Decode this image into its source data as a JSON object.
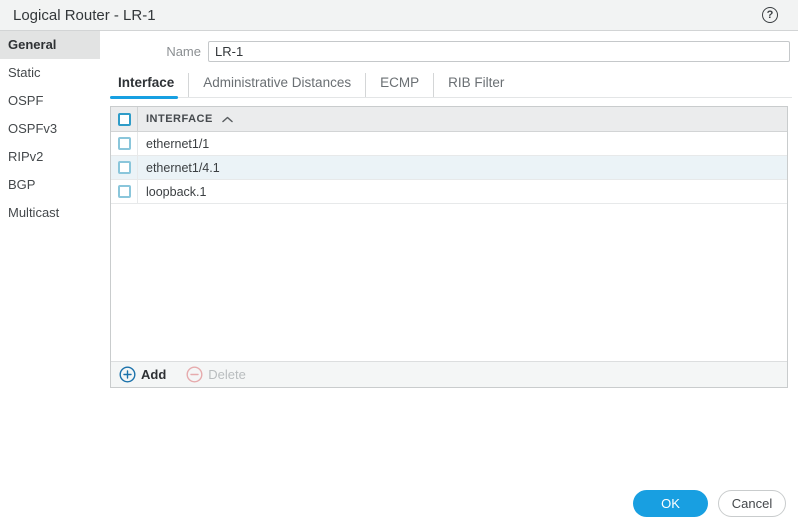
{
  "dialog": {
    "title": "Logical Router - LR-1",
    "help_glyph": "?"
  },
  "sidebar": {
    "items": [
      {
        "label": "General",
        "state": "active"
      },
      {
        "label": "Static"
      },
      {
        "label": "OSPF"
      },
      {
        "label": "OSPFv3"
      },
      {
        "label": "RIPv2"
      },
      {
        "label": "BGP"
      },
      {
        "label": "Multicast"
      }
    ]
  },
  "form": {
    "name_label": "Name",
    "name_value": "LR-1"
  },
  "tabs": {
    "items": [
      {
        "label": "Interface",
        "state": "active"
      },
      {
        "label": "Administrative Distances"
      },
      {
        "label": "ECMP"
      },
      {
        "label": "RIB Filter"
      }
    ]
  },
  "table": {
    "column_header": "INTERFACE",
    "sort_icon": "chevron-up",
    "rows": [
      {
        "interface": "ethernet1/1"
      },
      {
        "interface": "ethernet1/4.1",
        "state": "highlighted"
      },
      {
        "interface": "loopback.1"
      }
    ],
    "add_label": "Add",
    "delete_label": "Delete"
  },
  "footer_buttons": {
    "ok": "OK",
    "cancel": "Cancel"
  },
  "colors": {
    "accent_blue": "#189fe1",
    "tab_underline": "#17a0e2",
    "checkbox_blue": "#2f9cc8",
    "checkbox_blue_soft": "#8ac6db",
    "row_highlight": "#ebf3f7",
    "add_icon_blue": "#1b72ab",
    "delete_icon_pink": "#e6abad",
    "titlebar_gray": "#f2f3f3",
    "sidebar_active_gray": "#e2e3e3"
  }
}
